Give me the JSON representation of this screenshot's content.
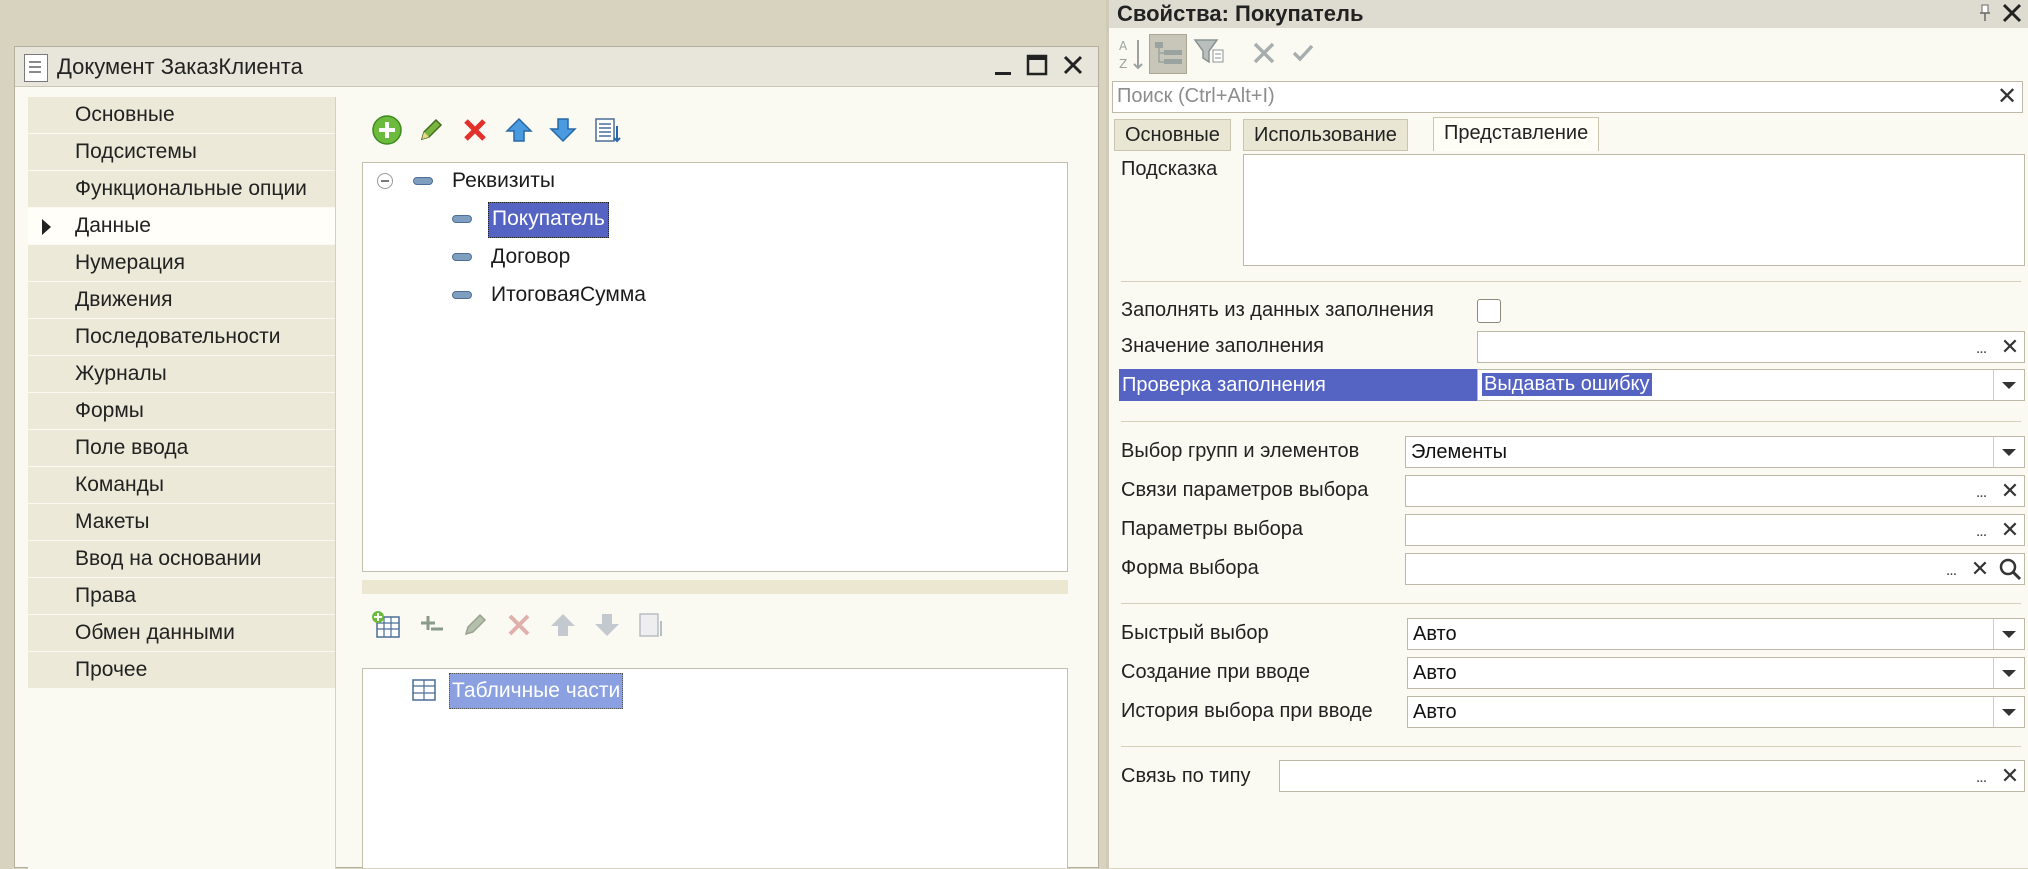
{
  "document_window": {
    "title": "Документ ЗаказКлиента",
    "controls": {
      "minimize": "—",
      "maximize": "□",
      "close": "✕"
    }
  },
  "sections": [
    {
      "label": "Основные"
    },
    {
      "label": "Подсистемы"
    },
    {
      "label": "Функциональные опции"
    },
    {
      "label": "Данные",
      "active": true
    },
    {
      "label": "Нумерация"
    },
    {
      "label": "Движения"
    },
    {
      "label": "Последовательности"
    },
    {
      "label": "Журналы"
    },
    {
      "label": "Формы"
    },
    {
      "label": "Поле ввода"
    },
    {
      "label": "Команды"
    },
    {
      "label": "Макеты"
    },
    {
      "label": "Ввод на основании"
    },
    {
      "label": "Права"
    },
    {
      "label": "Обмен данными"
    },
    {
      "label": "Прочее"
    }
  ],
  "attributes_tree": {
    "root": "Реквизиты",
    "items": [
      "Покупатель",
      "Договор",
      "ИтоговаяСумма"
    ],
    "selected": "Покупатель"
  },
  "tabular_tree": {
    "root": "Табличные части"
  },
  "properties": {
    "title": "Свойства: Покупатель",
    "search_placeholder": "Поиск (Ctrl+Alt+I)",
    "tabs": [
      "Основные",
      "Использование",
      "Представление"
    ],
    "active_tab": "Представление",
    "fields": {
      "hint_label": "Подсказка",
      "fill_from_data_label": "Заполнять из данных заполнения",
      "fill_value_label": "Значение заполнения",
      "fill_check_label": "Проверка заполнения",
      "fill_check_value": "Выдавать ошибку",
      "choice_groups_label": "Выбор групп и элементов",
      "choice_groups_value": "Элементы",
      "choice_links_label": "Связи параметров выбора",
      "choice_params_label": "Параметры выбора",
      "choice_form_label": "Форма выбора",
      "quick_choice_label": "Быстрый выбор",
      "quick_choice_value": "Авто",
      "create_on_input_label": "Создание при вводе",
      "create_on_input_value": "Авто",
      "choice_history_label": "История выбора при вводе",
      "choice_history_value": "Авто",
      "type_link_label": "Связь по типу"
    },
    "dots": "...",
    "clear_glyph": "✕"
  },
  "colors": {
    "selection": "#5563c3",
    "background": "#d7d3bf",
    "panel": "#fbfaf2",
    "section_item": "#ece9d8"
  }
}
